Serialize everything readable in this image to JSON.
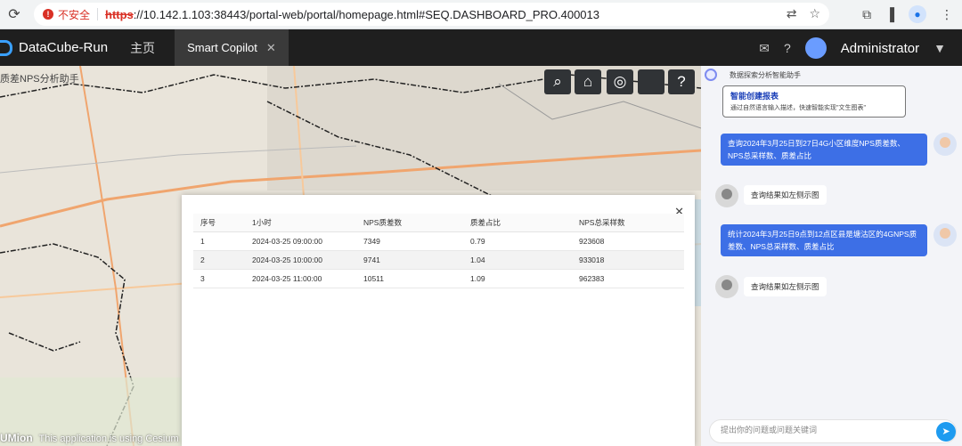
{
  "browser": {
    "security_label": "不安全",
    "url_protocol": "https",
    "url_rest": "://10.142.1.103:38443/portal-web/portal/homepage.html#SEQ.DASHBOARD_PRO.400013"
  },
  "header": {
    "app_title": "DataCube-Run",
    "nav_home": "主页",
    "active_tab": "Smart Copilot",
    "user_name": "Administrator"
  },
  "map": {
    "title": "质差NPS分析助手",
    "footer_logo": "UMion",
    "footer_text": "This application is using Cesium"
  },
  "table": {
    "headers": [
      "序号",
      "1小时",
      "NPS质差数",
      "质差占比",
      "NPS总采样数"
    ],
    "rows": [
      [
        "1",
        "2024-03-25 09:00:00",
        "7349",
        "0.79",
        "923608"
      ],
      [
        "2",
        "2024-03-25 10:00:00",
        "9741",
        "1.04",
        "933018"
      ],
      [
        "3",
        "2024-03-25 11:00:00",
        "10511",
        "1.09",
        "962383"
      ]
    ]
  },
  "chat": {
    "title": "数据探索分析智能助手",
    "card_title": "智能创建报表",
    "card_sub": "通过自然语言输入描述，快速智能实现\"文生图表\"",
    "msg1_user": "查询2024年3月25日到27日4G小区维度NPS质差数、NPS总采样数、质差占比",
    "msg1_bot": "查询结果如左侧示图",
    "msg2_user": "统计2024年3月25日9点到12点区县是塘沽区的4GNPS质差数、NPS总采样数、质差占比",
    "msg2_bot": "查询结果如左侧示图",
    "input_placeholder": "提出你的问题或问题关键词"
  }
}
